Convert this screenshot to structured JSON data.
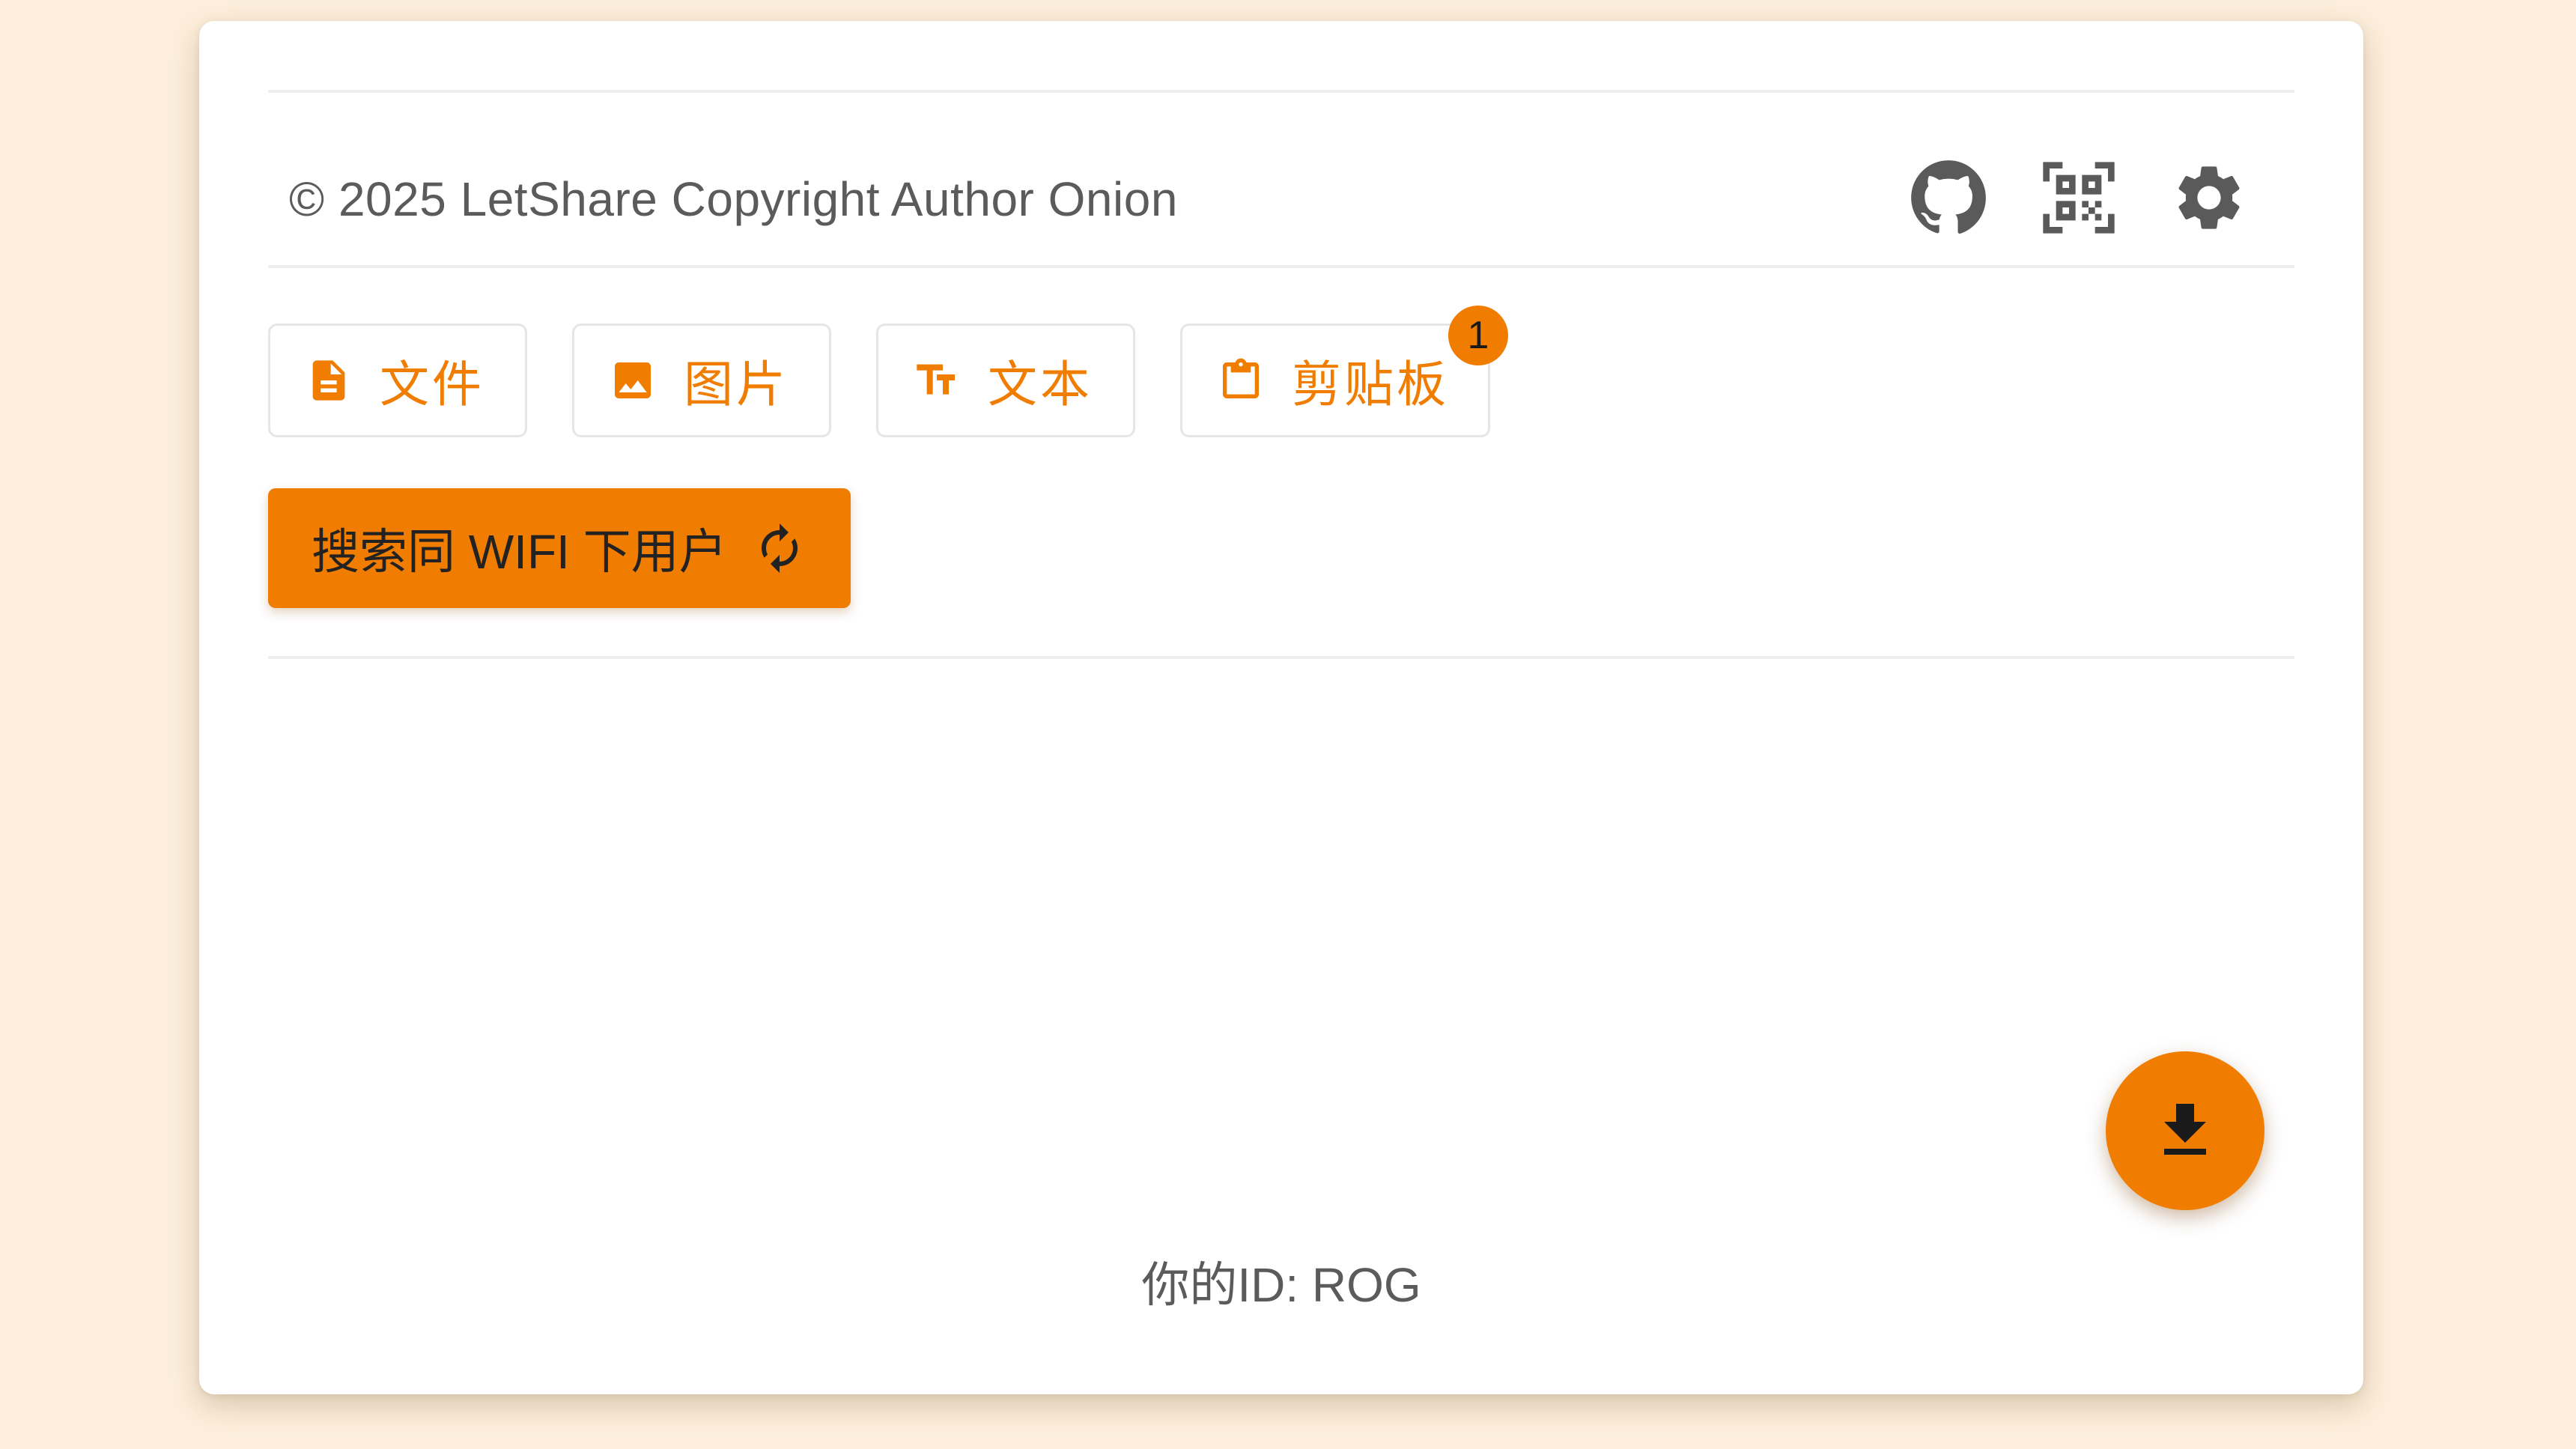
{
  "colors": {
    "page_background": "#fdefdc",
    "card_background": "#ffffff",
    "accent": "#f07c00",
    "text_muted": "#5b5b5b",
    "icon_gray": "#5a5a5a"
  },
  "header": {
    "copyright": "© 2025 LetShare Copyright Author Onion",
    "icons": [
      "github-icon",
      "qr-code-icon",
      "gear-icon"
    ]
  },
  "tabs": [
    {
      "label": "文件",
      "icon": "file-icon"
    },
    {
      "label": "图片",
      "icon": "image-icon"
    },
    {
      "label": "文本",
      "icon": "text-size-icon"
    },
    {
      "label": "剪贴板",
      "icon": "clipboard-icon",
      "badge": "1"
    }
  ],
  "search": {
    "label": "搜索同 WIFI 下用户",
    "icon": "refresh-icon"
  },
  "fab": {
    "icon": "download-icon"
  },
  "footer": {
    "id_text": "你的ID: ROG"
  }
}
